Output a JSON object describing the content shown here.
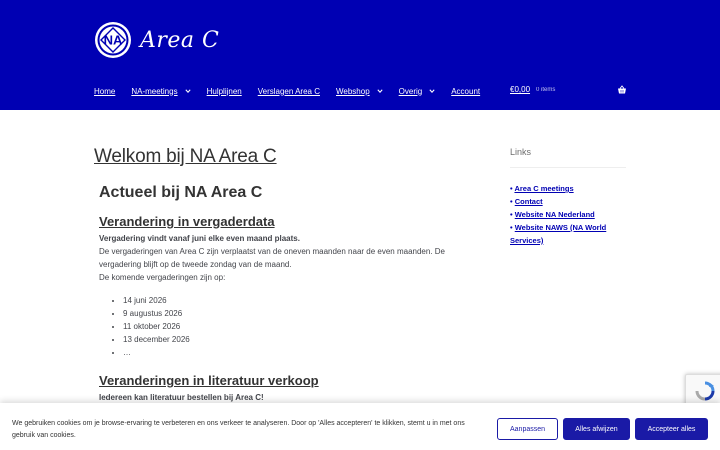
{
  "header": {
    "logo_text": "Area C",
    "logo_mark": "NA",
    "nav": [
      {
        "label": "Home",
        "dropdown": false
      },
      {
        "label": "NA-meetings",
        "dropdown": true
      },
      {
        "label": "Hulplijnen",
        "dropdown": false
      },
      {
        "label": "Verslagen Area C",
        "dropdown": false
      },
      {
        "label": "Webshop",
        "dropdown": true
      },
      {
        "label": "Overig",
        "dropdown": true
      },
      {
        "label": "Account",
        "dropdown": false
      }
    ],
    "cart": {
      "amount": "€0,00",
      "count": "0 items",
      "icon": "basket-icon"
    }
  },
  "main": {
    "page_title": "Welkom bij NA Area C",
    "heading": "Actueel bij NA Area C",
    "section1": {
      "title": "Verandering in vergaderdata",
      "lead": "Vergadering vindt vanaf juni elke even maand plaats.",
      "body1": "De vergaderingen van Area C zijn verplaatst van de oneven maanden naar de even maanden. De vergadering blijft op de tweede zondag van de maand.",
      "body2": "De komende vergaderingen zijn op:",
      "dates": [
        "14 juni 2026",
        "9 augustus 2026",
        "11 oktober 2026",
        "13 december 2026",
        "…"
      ]
    },
    "section2": {
      "title": "Veranderingen in literatuur verkoop",
      "lead": "Iedereen kan literatuur bestellen bij Area C!"
    }
  },
  "sidebar": {
    "title": "Links",
    "links": [
      "Area C meetings",
      "Contact",
      "Website NA Nederland",
      "Website NAWS (NA World Services)"
    ],
    "bullet": "•"
  },
  "cookie": {
    "text": "We gebruiken cookies om je browse-ervaring te verbeteren en ons verkeer te analyseren. Door op 'Alles accepteren' te klikken, stemt u in met ons gebruik van cookies.",
    "customize": "Aanpassen",
    "reject": "Alles afwijzen",
    "accept": "Accepteer alles"
  },
  "colors": {
    "header_bg": "#0000b3",
    "button": "#1a1aa6"
  }
}
